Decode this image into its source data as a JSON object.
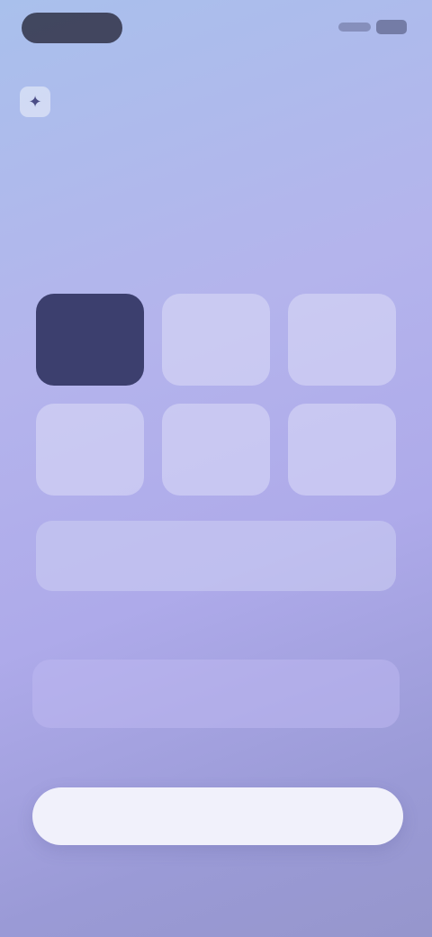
{
  "status": {
    "battery": ""
  },
  "header": {
    "skip_label": "",
    "app_name": "",
    "logo_icon": "sparkle-icon"
  },
  "question": {
    "headline": "",
    "subtitle": ""
  },
  "options": {
    "tiles": [
      {
        "label": "",
        "selected": true
      },
      {
        "label": "",
        "selected": false
      },
      {
        "label": "",
        "selected": false
      },
      {
        "label": "",
        "selected": false
      },
      {
        "label": "",
        "selected": false
      },
      {
        "label": "",
        "selected": false
      }
    ],
    "wide_label": ""
  },
  "custom": {
    "section_label": "",
    "input_value": "",
    "input_placeholder": "",
    "unit": ""
  },
  "footer": {
    "primary_button_label": "",
    "footnote": ""
  },
  "colors": {
    "accent": "#3c3f6e",
    "background_start": "#a9c0ec",
    "background_end": "#9696cc",
    "button": "#f1f1fb"
  }
}
